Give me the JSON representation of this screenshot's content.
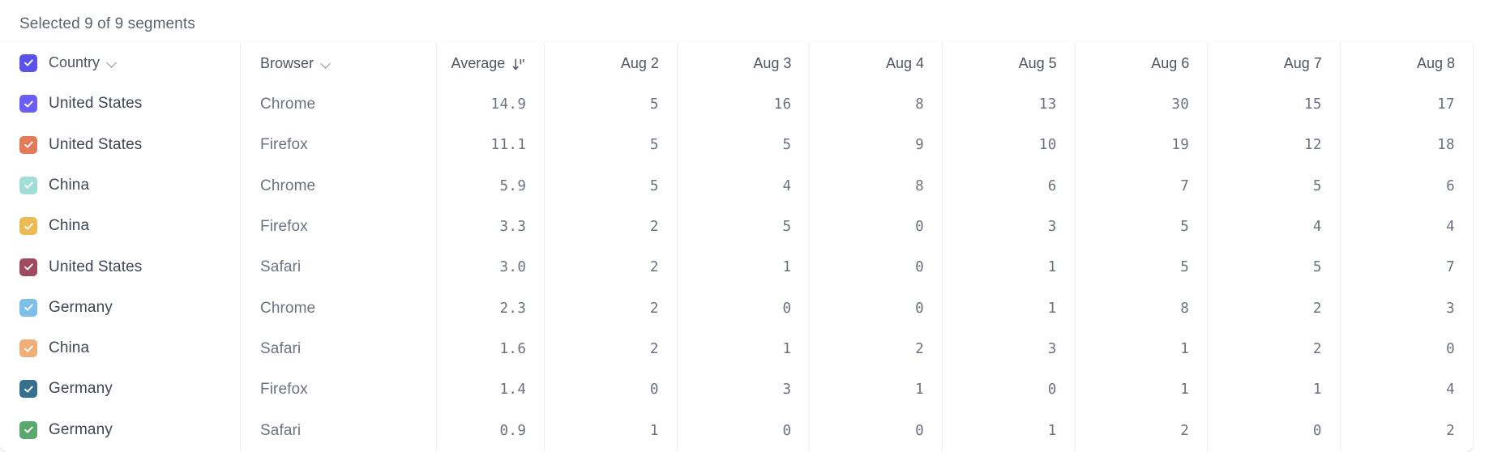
{
  "caption": "Selected 9 of 9 segments",
  "columns": {
    "country": "Country",
    "browser": "Browser",
    "average": "Average",
    "days": [
      "Aug 2",
      "Aug 3",
      "Aug 4",
      "Aug 5",
      "Aug 6",
      "Aug 7",
      "Aug 8"
    ]
  },
  "sort": {
    "column": "Average",
    "direction": "descending",
    "icon": "sort-descending-icon"
  },
  "header_checkbox": {
    "checked": true,
    "color": "#5b51eb"
  },
  "accent": "#5b51eb",
  "rows": [
    {
      "checked": true,
      "color": "#6c5ef5",
      "country": "United States",
      "browser": "Chrome",
      "average": "14.9",
      "days": [
        "5",
        "16",
        "8",
        "13",
        "30",
        "15",
        "17"
      ]
    },
    {
      "checked": true,
      "color": "#e37b58",
      "country": "United States",
      "browser": "Firefox",
      "average": "11.1",
      "days": [
        "5",
        "5",
        "9",
        "10",
        "19",
        "12",
        "18"
      ]
    },
    {
      "checked": true,
      "color": "#a2ded7",
      "country": "China",
      "browser": "Chrome",
      "average": "5.9",
      "days": [
        "5",
        "4",
        "8",
        "6",
        "7",
        "5",
        "6"
      ]
    },
    {
      "checked": true,
      "color": "#ecbb54",
      "country": "China",
      "browser": "Firefox",
      "average": "3.3",
      "days": [
        "2",
        "5",
        "0",
        "3",
        "5",
        "4",
        "4"
      ]
    },
    {
      "checked": true,
      "color": "#a04a60",
      "country": "United States",
      "browser": "Safari",
      "average": "3.0",
      "days": [
        "2",
        "1",
        "0",
        "1",
        "5",
        "5",
        "7"
      ]
    },
    {
      "checked": true,
      "color": "#7cc0ea",
      "country": "Germany",
      "browser": "Chrome",
      "average": "2.3",
      "days": [
        "2",
        "0",
        "0",
        "1",
        "8",
        "2",
        "3"
      ]
    },
    {
      "checked": true,
      "color": "#eeb078",
      "country": "China",
      "browser": "Safari",
      "average": "1.6",
      "days": [
        "2",
        "1",
        "2",
        "3",
        "1",
        "2",
        "0"
      ]
    },
    {
      "checked": true,
      "color": "#36708f",
      "country": "Germany",
      "browser": "Firefox",
      "average": "1.4",
      "days": [
        "0",
        "3",
        "1",
        "0",
        "1",
        "1",
        "4"
      ]
    },
    {
      "checked": true,
      "color": "#5aa86e",
      "country": "Germany",
      "browser": "Safari",
      "average": "0.9",
      "days": [
        "1",
        "0",
        "0",
        "1",
        "2",
        "0",
        "2"
      ]
    }
  ],
  "chart_data": {
    "type": "table",
    "title": "Selected 9 of 9 segments",
    "columns": [
      "Country",
      "Browser",
      "Average",
      "Aug 2",
      "Aug 3",
      "Aug 4",
      "Aug 5",
      "Aug 6",
      "Aug 7",
      "Aug 8"
    ],
    "sorted_by": "Average",
    "sort_direction": "descending",
    "series": [
      {
        "name": "United States / Chrome",
        "color": "#6c5ef5",
        "average": 14.9,
        "values": [
          5,
          16,
          8,
          13,
          30,
          15,
          17
        ]
      },
      {
        "name": "United States / Firefox",
        "color": "#e37b58",
        "average": 11.1,
        "values": [
          5,
          5,
          9,
          10,
          19,
          12,
          18
        ]
      },
      {
        "name": "China / Chrome",
        "color": "#a2ded7",
        "average": 5.9,
        "values": [
          5,
          4,
          8,
          6,
          7,
          5,
          6
        ]
      },
      {
        "name": "China / Firefox",
        "color": "#ecbb54",
        "average": 3.3,
        "values": [
          2,
          5,
          0,
          3,
          5,
          4,
          4
        ]
      },
      {
        "name": "United States / Safari",
        "color": "#a04a60",
        "average": 3.0,
        "values": [
          2,
          1,
          0,
          1,
          5,
          5,
          7
        ]
      },
      {
        "name": "Germany / Chrome",
        "color": "#7cc0ea",
        "average": 2.3,
        "values": [
          2,
          0,
          0,
          1,
          8,
          2,
          3
        ]
      },
      {
        "name": "China / Safari",
        "color": "#eeb078",
        "average": 1.6,
        "values": [
          2,
          1,
          2,
          3,
          1,
          2,
          0
        ]
      },
      {
        "name": "Germany / Firefox",
        "color": "#36708f",
        "average": 1.4,
        "values": [
          0,
          3,
          1,
          0,
          1,
          1,
          4
        ]
      },
      {
        "name": "Germany / Safari",
        "color": "#5aa86e",
        "average": 0.9,
        "values": [
          1,
          0,
          0,
          1,
          2,
          0,
          2
        ]
      }
    ],
    "x": [
      "Aug 2",
      "Aug 3",
      "Aug 4",
      "Aug 5",
      "Aug 6",
      "Aug 7",
      "Aug 8"
    ],
    "xlabel": "",
    "ylabel": ""
  }
}
